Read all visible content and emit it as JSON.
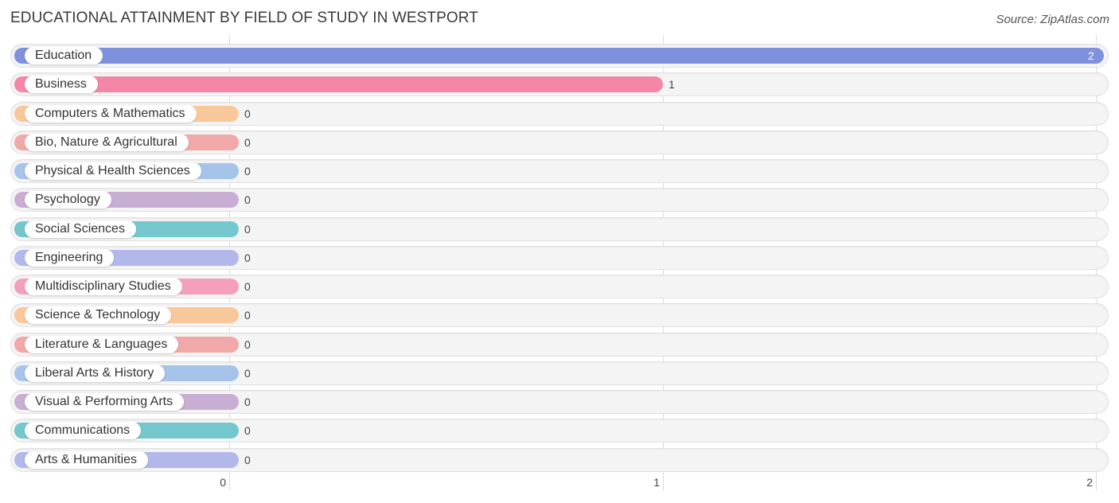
{
  "header": {
    "title": "EDUCATIONAL ATTAINMENT BY FIELD OF STUDY IN WESTPORT",
    "source": "Source: ZipAtlas.com"
  },
  "chart_data": {
    "type": "bar",
    "orientation": "horizontal",
    "title": "EDUCATIONAL ATTAINMENT BY FIELD OF STUDY IN WESTPORT",
    "xlabel": "",
    "ylabel": "",
    "xlim": [
      0,
      2
    ],
    "x_ticks": [
      "0",
      "1",
      "2"
    ],
    "grid": true,
    "categories": [
      "Education",
      "Business",
      "Computers & Mathematics",
      "Bio, Nature & Agricultural",
      "Physical & Health Sciences",
      "Psychology",
      "Social Sciences",
      "Engineering",
      "Multidisciplinary Studies",
      "Science & Technology",
      "Literature & Languages",
      "Liberal Arts & History",
      "Visual & Performing Arts",
      "Communications",
      "Arts & Humanities"
    ],
    "values": [
      2,
      1,
      0,
      0,
      0,
      0,
      0,
      0,
      0,
      0,
      0,
      0,
      0,
      0,
      0
    ],
    "value_labels": [
      "2",
      "1",
      "0",
      "0",
      "0",
      "0",
      "0",
      "0",
      "0",
      "0",
      "0",
      "0",
      "0",
      "0",
      "0"
    ],
    "colors": [
      "#7f91dc",
      "#f487a8",
      "#f9c89a",
      "#f0a8a8",
      "#a6c3ea",
      "#c9aed4",
      "#74c7cc",
      "#b2b9ea",
      "#f59fbd",
      "#f9c89a",
      "#f0a8a8",
      "#a6c3ea",
      "#c9aed4",
      "#74c7cc",
      "#b2b9ea"
    ]
  }
}
